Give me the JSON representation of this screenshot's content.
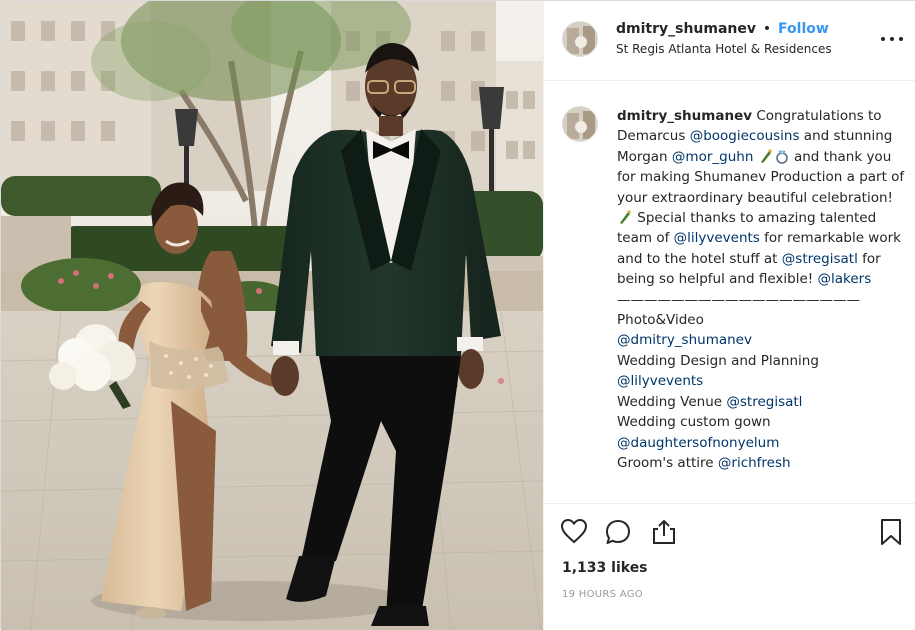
{
  "post": {
    "photo_alt": "dmitry_shumanev wedding photo",
    "username": "dmitry_shumanev",
    "separator": "•",
    "follow_label": "Follow",
    "location": "St Regis Atlanta Hotel & Residences",
    "more_icon": "more-options-icon"
  },
  "caption": {
    "username": "dmitry_shumanev",
    "t1": " Congratulations to Demarcus ",
    "m1": "@boogiecousins",
    "t2": " and stunning Morgan ",
    "m2": "@mor_guhn",
    "t3": " and thank you for making Shumanev Production a part of your extraordinary beautiful celebration! ",
    "t4": " Special thanks to amazing talented team of ",
    "m3": "@lilyvevents",
    "t5": " for remarkable work and to the hotel stuff at ",
    "m4": "@stregisatl",
    "t6": " for being so helpful and flexible! ",
    "m5": "@lakers",
    "divider": "——————————————————Photo&Video",
    "m6": "@dmitry_shumanev",
    "t7": "Wedding Design and Planning",
    "m7": "@lilyvevents",
    "t8": "Wedding Venue ",
    "m8": "@stregisatl",
    "t9": "Wedding custom gown",
    "m9": "@daughtersofnonyelum",
    "t10": "Groom's attire ",
    "m10": "@richfresh"
  },
  "actions": {
    "likes": "1,133 likes",
    "time_ago": "19 HOURS AGO",
    "icons": [
      "heart-icon",
      "comment-icon",
      "share-icon",
      "bookmark-icon"
    ]
  },
  "colors": {
    "link": "#003569",
    "follow": "#3897f0",
    "text": "#262626",
    "muted": "#999999"
  }
}
